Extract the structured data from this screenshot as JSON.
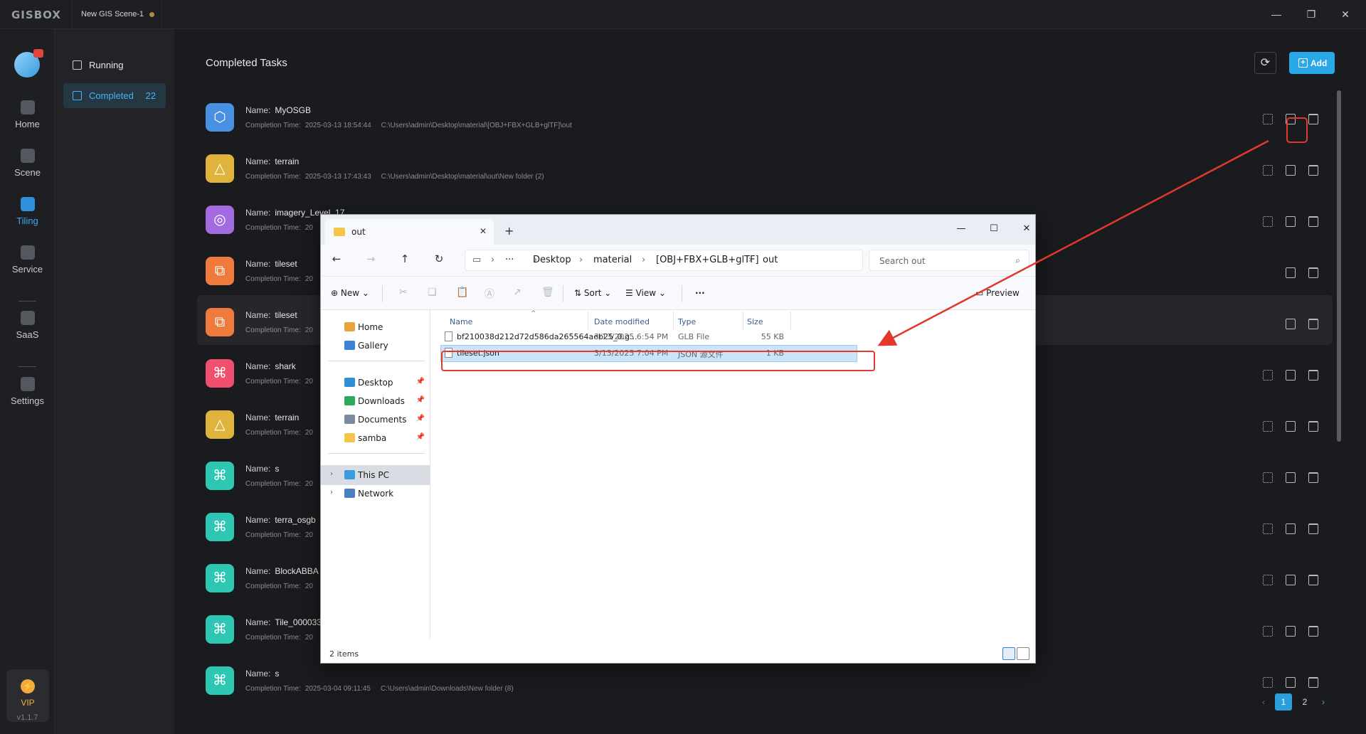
{
  "app": {
    "logo": "GISBOX",
    "scene_tab": "New GIS Scene-1",
    "version": "v1.1.7"
  },
  "window_controls": {
    "minimize": "—",
    "restore": "❐",
    "close": "✕"
  },
  "left_nav": {
    "items": [
      {
        "label": "Home",
        "icon": "home-icon"
      },
      {
        "label": "Scene",
        "icon": "cube-icon"
      },
      {
        "label": "Tiling",
        "icon": "tiling-icon",
        "active": true
      },
      {
        "label": "Service",
        "icon": "service-icon"
      },
      {
        "label": "SaaS",
        "icon": "lock-icon"
      },
      {
        "label": "Settings",
        "icon": "gear-icon"
      }
    ],
    "vip_label": "VIP"
  },
  "sub_nav": {
    "running": "Running",
    "completed": "Completed",
    "completed_count": "22"
  },
  "main": {
    "title": "Completed Tasks",
    "add_label": "Add",
    "name_prefix": "Name:",
    "time_prefix": "Completion Time:",
    "tasks": [
      {
        "name": "MyOSGB",
        "time": "2025-03-13 18:54:44",
        "path": "C:\\Users\\admin\\Desktop\\material\\[OBJ+FBX+GLB+glTF]\\out",
        "icon": "cube-icon",
        "color": "#4a90e2"
      },
      {
        "name": "terrain",
        "time": "2025-03-13 17:43:43",
        "path": "C:\\Users\\admin\\Desktop\\material\\out\\New folder (2)",
        "icon": "terrain-icon",
        "color": "#e0b43c"
      },
      {
        "name": "imagery_Level_17",
        "time": "20",
        "path": "",
        "icon": "imagery-icon",
        "color": "#a46be0"
      },
      {
        "name": "tileset",
        "time": "20",
        "path": "",
        "icon": "tileset-icon",
        "color": "#f07a3c"
      },
      {
        "name": "tileset",
        "time": "20",
        "path": "",
        "icon": "tileset-icon",
        "color": "#f07a3c"
      },
      {
        "name": "shark",
        "time": "20",
        "path": "",
        "icon": "model-icon",
        "color": "#f0506e"
      },
      {
        "name": "terrain",
        "time": "20",
        "path": "",
        "icon": "terrain-icon",
        "color": "#e0b43c"
      },
      {
        "name": "s",
        "time": "20",
        "path": "",
        "icon": "model-icon",
        "color": "#2dc7b4"
      },
      {
        "name": "terra_osgb",
        "time": "20",
        "path": "",
        "icon": "model-icon",
        "color": "#2dc7b4"
      },
      {
        "name": "BlockABBA",
        "time": "20",
        "path": "",
        "icon": "model-icon",
        "color": "#2dc7b4"
      },
      {
        "name": "Tile_000033",
        "time": "20",
        "path": "",
        "icon": "model-icon",
        "color": "#2dc7b4"
      },
      {
        "name": "s",
        "time": "2025-03-04 09:11:45",
        "path": "C:\\Users\\admin\\Downloads\\New folder (8)",
        "icon": "model-icon",
        "color": "#2dc7b4"
      }
    ],
    "pagination": {
      "current": "1",
      "next": "2"
    }
  },
  "explorer": {
    "tab_title": "out",
    "breadcrumb": [
      "Desktop",
      "material",
      "[OBJ+FBX+GLB+glTF]",
      "out"
    ],
    "search_placeholder": "Search out",
    "toolbar": {
      "new": "New",
      "sort": "Sort",
      "view": "View",
      "more": "···",
      "preview": "Preview"
    },
    "sidebar": {
      "home": "Home",
      "gallery": "Gallery",
      "quick": [
        "Desktop",
        "Downloads",
        "Documents",
        "samba"
      ],
      "this_pc": "This PC",
      "network": "Network"
    },
    "columns": {
      "name": "Name",
      "date": "Date modified",
      "type": "Type",
      "size": "Size"
    },
    "files": [
      {
        "name": "bf210038d212d72d586da265564aeb25_0.g...",
        "date": "3/13/2025 6:54 PM",
        "type": "GLB File",
        "size": "55 KB"
      },
      {
        "name": "tileset.json",
        "date": "3/13/2025 7:04 PM",
        "type": "JSON 源文件",
        "size": "1 KB"
      }
    ],
    "status": "2 items"
  },
  "colors": {
    "accent": "#29a7e6",
    "annotation_red": "#e2392c"
  }
}
